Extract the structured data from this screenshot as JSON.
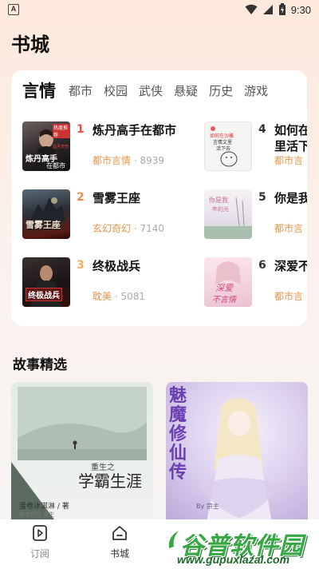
{
  "status_bar": {
    "app_badge": "A",
    "time": "9:30"
  },
  "page_title": "书城",
  "ranking": {
    "tabs": [
      {
        "label": "言情",
        "active": true
      },
      {
        "label": "都市"
      },
      {
        "label": "校园"
      },
      {
        "label": "武侠"
      },
      {
        "label": "悬疑"
      },
      {
        "label": "历史"
      },
      {
        "label": "游戏"
      }
    ],
    "books": [
      {
        "rank": "1",
        "title": "炼丹高手在都市",
        "category": "都市言情",
        "separator": "·",
        "count": "8939",
        "rank_color": "#e8544a"
      },
      {
        "rank": "2",
        "title": "雪雾王座",
        "category": "玄幻奇幻",
        "separator": "·",
        "count": "7140",
        "rank_color": "#ef8a4a"
      },
      {
        "rank": "3",
        "title": "终极战兵",
        "category": "耽美",
        "separator": "·",
        "count": "5081",
        "rank_color": "#f3b160"
      },
      {
        "rank": "4",
        "title": "如何在",
        "title_line2": "里活下",
        "category": "都市言"
      },
      {
        "rank": "5",
        "title": "你是我",
        "category": "都市言"
      },
      {
        "rank": "6",
        "title": "深爱不",
        "category": "都市言"
      }
    ],
    "cover_texts": {
      "c1_top": "热度推荐",
      "c1_main": "炼丹高手",
      "c1_sub": "在都市",
      "c1_side": "血月天伤",
      "c2_main": "雪雾王座",
      "c3_main": "终极战兵",
      "c4_main": "如何在沙雕",
      "c4_sub": "言情文里",
      "c4_sub2": "活下去",
      "c5_main": "你是我",
      "c5_sub": "年的光",
      "c6_main": "深爱",
      "c6_sub": "不言情"
    }
  },
  "stories": {
    "section_title": "故事精选",
    "items": [
      {
        "cover_title_small": "重生之",
        "cover_title": "学霸生涯",
        "author_line": "蛋卷冰淇淋 / 著",
        "tag_line": "都市情感 重生"
      },
      {
        "cover_title": "魅魔修仙传",
        "author_line": "By 宗主"
      }
    ]
  },
  "bottom_nav": {
    "items": [
      {
        "label": "订阅",
        "icon": "bookmark-icon"
      },
      {
        "label": "书城",
        "icon": "home-icon",
        "active": true
      }
    ]
  },
  "watermark": {
    "main": "谷普软件园",
    "url": "www.gupuxlazal.com"
  },
  "colors": {
    "accent": "#e8944a",
    "rank1": "#e8544a",
    "rank2": "#ef8a4a",
    "rank3": "#f3b160",
    "watermark_green": "#35a843"
  }
}
